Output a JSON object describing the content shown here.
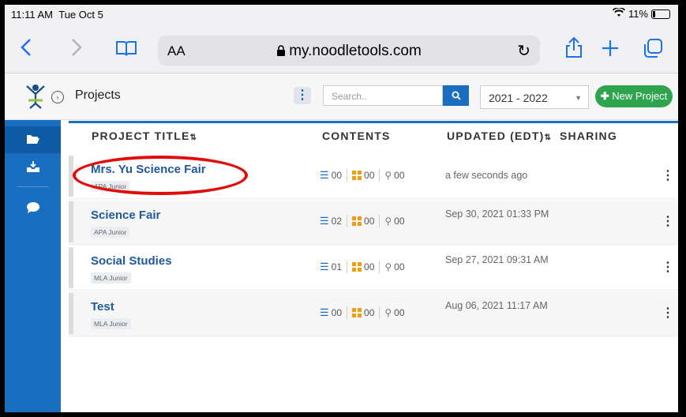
{
  "status": {
    "time": "11:11 AM",
    "date": "Tue Oct 5",
    "battery": "11%"
  },
  "safari": {
    "text_size_label": "AA",
    "url": "my.noodletools.com"
  },
  "header": {
    "breadcrumb": "Projects",
    "search_placeholder": "Search..",
    "year_selected": "2021 - 2022",
    "new_project_label": "New Project"
  },
  "table": {
    "columns": {
      "title": "PROJECT TITLE",
      "contents": "CONTENTS",
      "updated": "UPDATED (EDT)",
      "sharing": "SHARING"
    },
    "rows": [
      {
        "title": "Mrs. Yu Science Fair",
        "tag": "APA Junior",
        "sources": "00",
        "notecards": "00",
        "attachments": "00",
        "updated": "a few seconds ago"
      },
      {
        "title": "Science Fair",
        "tag": "APA Junior",
        "sources": "02",
        "notecards": "00",
        "attachments": "00",
        "updated": "Sep 30, 2021 01:33 PM"
      },
      {
        "title": "Social Studies",
        "tag": "MLA Junior",
        "sources": "01",
        "notecards": "00",
        "attachments": "00",
        "updated": "Sep 27, 2021 09:31 AM"
      },
      {
        "title": "Test",
        "tag": "MLA Junior",
        "sources": "00",
        "notecards": "00",
        "attachments": "00",
        "updated": "Aug 06, 2021 11:17 AM"
      }
    ]
  },
  "colors": {
    "primary": "#1a6ec0",
    "success": "#2ea44f",
    "annotation": "#e10b0b",
    "notecard": "#f39c12"
  }
}
